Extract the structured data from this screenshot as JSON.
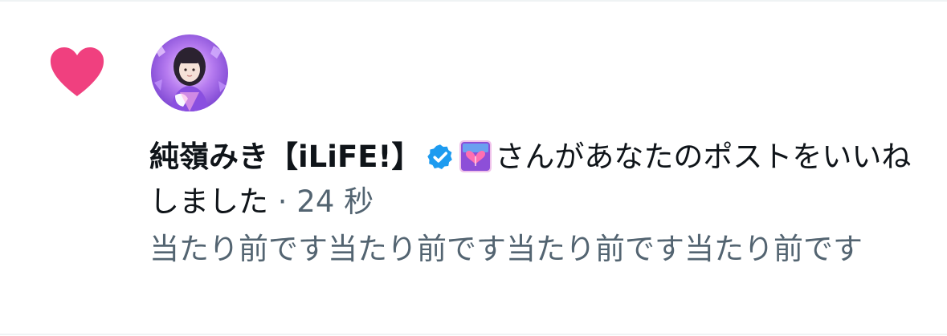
{
  "notification": {
    "type_icon": "heart-icon",
    "avatar_icon": "avatar",
    "user_name": "純嶺みき【iLiFE!】",
    "verified_icon": "verified-badge-icon",
    "affiliate_icon": "ilife-affiliate-badge",
    "action_text": "さんがあなたのポストをいいねしました",
    "time_separator": " · ",
    "timestamp": "24 秒",
    "post_preview": "当たり前です当たり前です当たり前です当たり前です"
  },
  "colors": {
    "heart": "#f0407f",
    "verified": "#1d9bf0",
    "text_primary": "#0f1419",
    "text_secondary": "#536471",
    "divider": "#eff3f4"
  }
}
